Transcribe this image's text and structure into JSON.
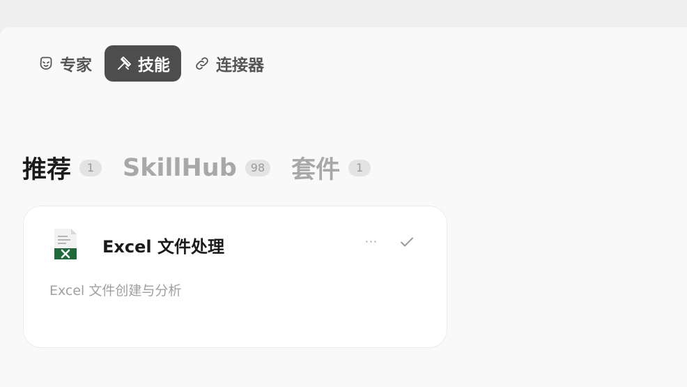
{
  "top_tabs": [
    {
      "label": "专家",
      "icon": "expert-icon",
      "active": false
    },
    {
      "label": "技能",
      "icon": "skill-icon",
      "active": true
    },
    {
      "label": "连接器",
      "icon": "link-icon",
      "active": false
    }
  ],
  "section_tabs": [
    {
      "label": "推荐",
      "count": "1",
      "active": true
    },
    {
      "label": "SkillHub",
      "count": "98",
      "active": false
    },
    {
      "label": "套件",
      "count": "1",
      "active": false
    }
  ],
  "skill_card": {
    "icon": "excel-file-icon",
    "title": "Excel 文件处理",
    "description": "Excel 文件创建与分析",
    "more_label": "···",
    "status_icon": "check-icon"
  },
  "colors": {
    "window_bg": "#efefef",
    "panel_bg": "#f9f9f9",
    "active_tab_bg": "#4d4d4d",
    "excel_green": "#1e6b3a"
  }
}
